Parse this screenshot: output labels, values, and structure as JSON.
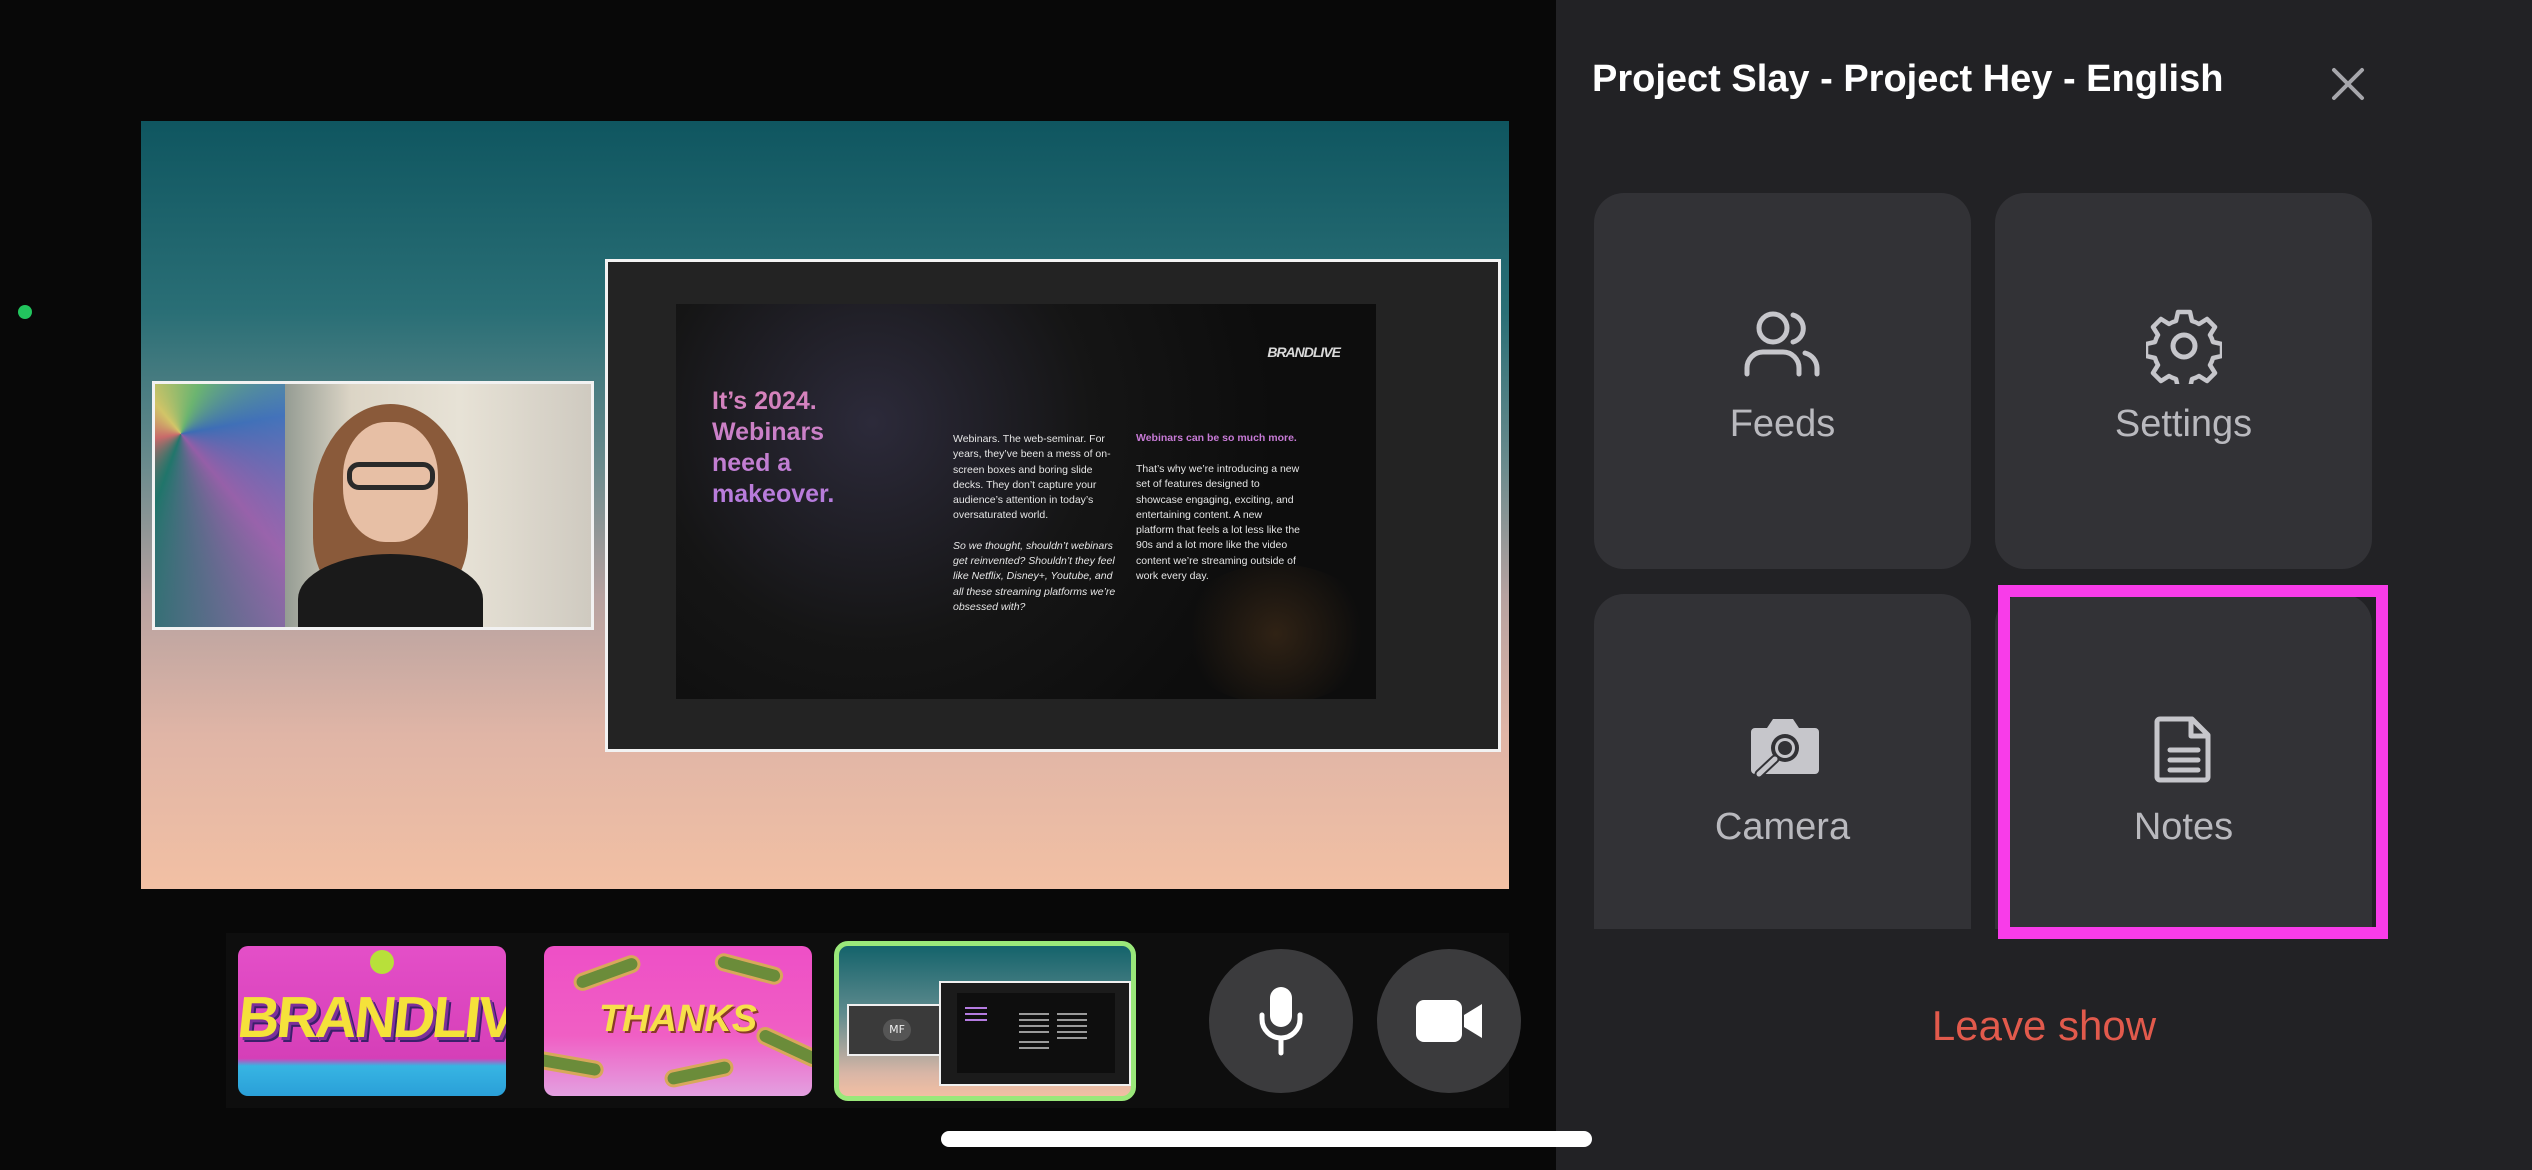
{
  "panel": {
    "title": "Project Slay - Project Hey - English",
    "tiles": [
      {
        "label": "Feeds",
        "icon": "users-icon"
      },
      {
        "label": "Settings",
        "icon": "gear-icon"
      },
      {
        "label": "Camera",
        "icon": "camera-icon"
      },
      {
        "label": "Notes",
        "icon": "document-icon"
      }
    ],
    "leave_label": "Leave show",
    "highlight_color": "#f83ce9",
    "leave_color": "#e25a4c"
  },
  "stage": {
    "slide": {
      "logo": "BRANDLIVE",
      "headline": "It’s 2024. Webinars need a makeover.",
      "col1_p1": "Webinars. The web-seminar. For years, they’ve been a mess of on-screen boxes and boring slide decks. They don’t capture your audience’s attention in today’s oversaturated world.",
      "col1_p2": "So we thought, shouldn’t webinars get reinvented? Shouldn’t they feel like Netflix, Disney+, Youtube, and all these streaming platforms we’re obsessed with?",
      "col2_head": "Webinars can be so much more.",
      "col2_body": "That’s why we’re introducing a new set of features designed to showcase engaging, exciting, and entertaining content. A new platform that feels a lot less like the 90s and a lot more like the video content we’re streaming outside of work every day."
    }
  },
  "scenes": [
    {
      "label": "BRANDLIVE"
    },
    {
      "label": "THANKS"
    },
    {
      "initials": "MF",
      "selected": true
    }
  ],
  "controls": {
    "mic_icon": "microphone-icon",
    "video_icon": "video-camera-icon"
  },
  "colors": {
    "live_dot": "#22c55e",
    "selected_scene_border": "#9ae87a"
  }
}
